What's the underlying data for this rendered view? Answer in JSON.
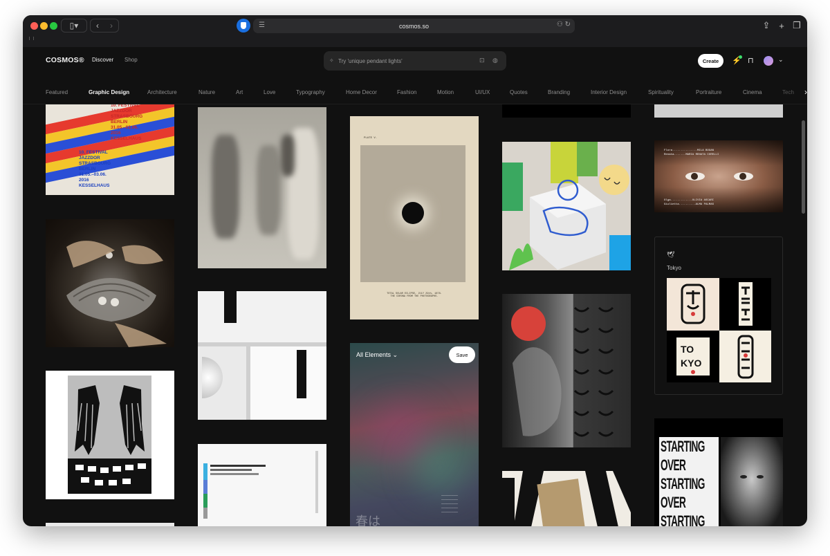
{
  "browser": {
    "url": "cosmos.so"
  },
  "header": {
    "logo": "COSMOS®",
    "nav": [
      "Discover",
      "Shop"
    ],
    "search_placeholder": "Try 'unique pendant lights'",
    "create_label": "Create"
  },
  "categories": [
    "Featured",
    "Graphic Design",
    "Architecture",
    "Nature",
    "Art",
    "Love",
    "Typography",
    "Home Decor",
    "Fashion",
    "Motion",
    "UI/UX",
    "Quotes",
    "Branding",
    "Interior Design",
    "Spirituality",
    "Portraiture",
    "Cinema",
    "Tech"
  ],
  "active_category": "Graphic Design",
  "tiles": {
    "jazz_poster_text": "10. FESTIVAL\nJAZZDOR\nSTRASBOURG\nBERLIN\n31.05.–03.06.\n2016\nKESSELHAUS",
    "jazz_poster_text_top": "10. FESTIVAL\nJAZZDOR\nSTRASBOURG\nBERLIN\n31.05.–03.06.\n2016\nKESSELHAUS",
    "eclipse_plate": "PLATE V.",
    "eclipse_caption": "TOTAL SOLAR ECLIPSE, JULY 29th, 1878.\nTHE CORONA FROM THE PHOTOGRAPHS.",
    "gradient_dropdown": "All Elements",
    "gradient_save": "Save",
    "gradient_jp": "春は",
    "tokyo_label": "Tokyo",
    "starting_over": [
      "STARTING",
      "OVER",
      "STARTING",
      "OVER",
      "STARTING"
    ],
    "eyes_credits_top": "Flora...............MILA BOGAN\nRenata.......MARIA RENATA CORELLI",
    "eyes_credits_bottom": "Olga.............OLIVIA ASCARI\nGiulietta..........ALMA PALMAS"
  }
}
